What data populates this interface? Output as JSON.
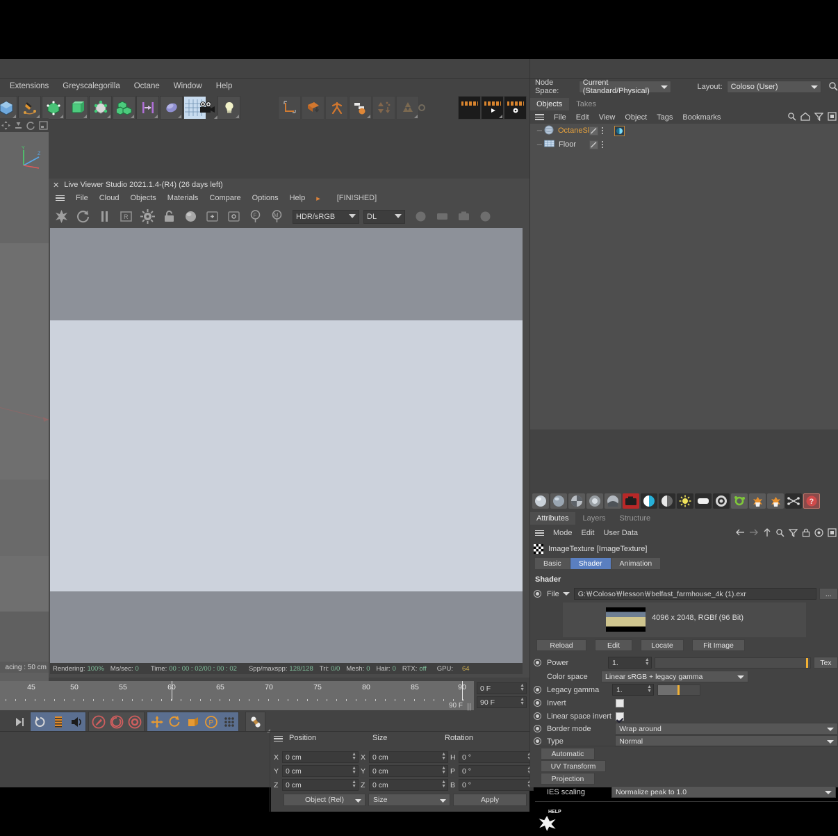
{
  "window": {
    "minimize": "–",
    "maximize": "□",
    "close": "✕"
  },
  "menubar": {
    "items": [
      "Extensions",
      "Greyscalegorilla",
      "Octane",
      "Window",
      "Help"
    ]
  },
  "toolbar_top": {
    "icons": [
      "cube-icon",
      "pen-spline-icon",
      "deformer-icon",
      "extrude-nurbs-icon",
      "subdivision-surface-icon",
      "array-icon",
      "align-icon",
      "metaball-icon",
      "floor-grid-icon",
      "camera-icon",
      "light-icon"
    ],
    "icons2": [
      "axis-coordinate-icon",
      "layer-drop-icon",
      "character-icon",
      "motion-graphics-icon",
      "simulate-icon",
      "recycle-icon"
    ],
    "render_icons": [
      "render-view-icon",
      "render-picture-viewer-icon",
      "render-settings-icon"
    ]
  },
  "viewport_left": {
    "spacing_label": "acing : 50 cm",
    "tools": [
      "move-icon",
      "scale-icon",
      "rotate-icon",
      "frame-icon"
    ]
  },
  "live_viewer": {
    "title": "Live Viewer Studio 2021.1.4-(R4) (26 days left)",
    "close": "✕",
    "menu": [
      "File",
      "Cloud",
      "Objects",
      "Materials",
      "Compare",
      "Options",
      "Help"
    ],
    "arrow": "▸",
    "status_badge": "[FINISHED]",
    "toolbar_icons": [
      "octane-render-icon",
      "refresh-icon",
      "pause-icon",
      "region-render-icon",
      "settings-gear-icon",
      "lock-icon",
      "material-sphere-icon",
      "add-region-icon",
      "object-region-icon",
      "focus-picker-icon",
      "material-picker-icon"
    ],
    "color_space": "HDR/sRGB",
    "render_kernel": "DL",
    "right_icons": [
      "sphere-preview-icon",
      "plane-preview-icon",
      "camera-preview-icon",
      "ball-preview-icon"
    ],
    "status": {
      "rendering_label": "Rendering:",
      "rendering_value": "100%",
      "ms_label": "Ms/sec:",
      "ms_value": "0",
      "time_label": "Time:",
      "time_value": "00 : 00 : 02/00 : 00 : 02",
      "spp_label": "Spp/maxspp:",
      "spp_value": "128/128",
      "tri_label": "Tri:",
      "tri_value": "0/0",
      "mesh_label": "Mesh:",
      "mesh_value": "0",
      "hair_label": "Hair:",
      "hair_value": "0",
      "rtx_label": "RTX:",
      "rtx_value": "off",
      "gpu_label": "GPU:",
      "gpu_value": "64"
    }
  },
  "timeline": {
    "ticks": [
      "45",
      "50",
      "55",
      "60",
      "65",
      "70",
      "75",
      "80",
      "85",
      "90"
    ],
    "current_frame": "0 F",
    "end_frame_display": "90 F",
    "range_end": "90 F"
  },
  "bottom_toolbar": {
    "groups": [
      [
        "move-to-end-icon"
      ],
      [
        "loop-playback-icon",
        "frame-strip-icon",
        "sound-icon"
      ],
      [
        "record-key-icon",
        "auto-key-icon",
        "key-settings-icon"
      ],
      [
        "position-key-icon",
        "rotation-key-icon",
        "scale-key-icon",
        "param-key-icon",
        "point-level-anim-icon"
      ],
      [
        "keyframe-selection-icon"
      ]
    ]
  },
  "coordinates": {
    "headers": {
      "position": "Position",
      "size": "Size",
      "rotation": "Rotation"
    },
    "position": {
      "x_label": "X",
      "x": "0 cm",
      "y_label": "Y",
      "y": "0 cm",
      "z_label": "Z",
      "z": "0 cm"
    },
    "size": {
      "x_label": "X",
      "x": "0 cm",
      "y_label": "Y",
      "y": "0 cm",
      "z_label": "Z",
      "z": "0 cm"
    },
    "rotation": {
      "h_label": "H",
      "h": "0 °",
      "p_label": "P",
      "p": "0 °",
      "b_label": "B",
      "b": "0 °"
    },
    "mode_select": "Object (Rel)",
    "size_select": "Size",
    "apply_button": "Apply"
  },
  "right_panel": {
    "node_space_label": "Node Space:",
    "node_space_value": "Current (Standard/Physical)",
    "layout_label": "Layout:",
    "layout_value": "Coloso (User)",
    "search_icon": "search-icon",
    "object_tabs": [
      {
        "label": "Objects",
        "active": true
      },
      {
        "label": "Takes",
        "active": false
      }
    ],
    "object_menu": [
      "File",
      "Edit",
      "View",
      "Object",
      "Tags",
      "Bookmarks"
    ],
    "object_menu_icons": [
      "search-icon",
      "home-icon",
      "filter-icon",
      "expand-panel-icon"
    ],
    "objects": [
      {
        "name": "OctaneSky",
        "icon": "sky-sphere-icon",
        "selected": true,
        "has_tag": true
      },
      {
        "name": "Floor",
        "icon": "floor-grid-icon",
        "selected": false,
        "has_tag": false
      }
    ],
    "material_icons": [
      "sphere-grey-icon",
      "sphere-dark-icon",
      "sphere-quarter-icon",
      "sphere-small-icon",
      "sphere-mix-icon",
      "camera-red-icon",
      "half-cyan-icon",
      "half-grey-icon",
      "sun-icon",
      "rect-white-icon",
      "target-icon",
      "green-knot-icon",
      "orange-burst-icon",
      "orange-burst2-icon",
      "shuffle-icon",
      "question-red-icon"
    ],
    "attr_tabs": [
      {
        "label": "Attributes",
        "active": true
      },
      {
        "label": "Layers",
        "active": false
      },
      {
        "label": "Structure",
        "active": false
      }
    ],
    "attr_menu": [
      "Mode",
      "Edit",
      "User Data"
    ],
    "attr_menu_icons": [
      "back-arrow-icon",
      "forward-arrow-icon",
      "up-arrow-icon",
      "search-icon",
      "filter-icon",
      "lock-icon",
      "target-icon",
      "expand-panel-icon"
    ],
    "object_title": "ImageTexture [ImageTexture]",
    "shader_tabs": [
      {
        "label": "Basic",
        "active": false
      },
      {
        "label": "Shader",
        "active": true
      },
      {
        "label": "Animation",
        "active": false
      }
    ],
    "shader_section": "Shader",
    "file_row": {
      "label": "File",
      "value": "G:￦Coloso￦lesson￦belfast_farmhouse_4k (1).exr",
      "browse_button": "..."
    },
    "image_info": "4096 x 2048, RGBf (96 Bit)",
    "image_buttons": [
      "Reload",
      "Edit",
      "Locate",
      "Fit Image"
    ],
    "power": {
      "label": "Power",
      "value": "1.",
      "tex_button": "Tex"
    },
    "color_space": {
      "label": "Color space",
      "value": "Linear sRGB + legacy gamma"
    },
    "legacy_gamma": {
      "label": "Legacy gamma",
      "value": "1."
    },
    "invert": {
      "label": "Invert",
      "checked": false
    },
    "linear_space_invert": {
      "label": "Linear space invert",
      "checked": true
    },
    "border_mode": {
      "label": "Border mode",
      "value": "Wrap around"
    },
    "type": {
      "label": "Type",
      "value": "Normal"
    },
    "proj_buttons": [
      "Automatic",
      "UV Transform",
      "Projection"
    ],
    "ies_scaling": {
      "label": "IES scaling",
      "value": "Normalize peak to 1.0"
    },
    "help_label": "HELP"
  },
  "colors": {
    "panel_bg": "#434343",
    "panel_bg_light": "#4e4e4e",
    "accent_blue": "#5a7fc0",
    "accent_orange": "#e8a33d",
    "slider_marker": "#f2b134",
    "status_green": "#7fbd9a"
  }
}
